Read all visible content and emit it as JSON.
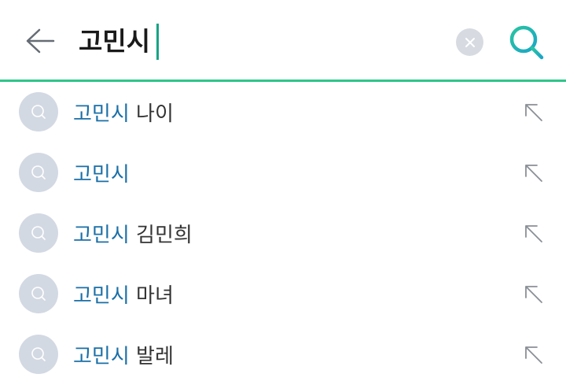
{
  "search": {
    "query": "고민시",
    "back_icon": "arrow-left-icon",
    "clear_icon": "close-icon",
    "search_icon": "search-icon",
    "accent_color": "#2fc58a"
  },
  "suggestions": [
    {
      "highlight": "고민시",
      "rest": " 나이"
    },
    {
      "highlight": "고민시",
      "rest": ""
    },
    {
      "highlight": "고민시",
      "rest": " 김민희"
    },
    {
      "highlight": "고민시",
      "rest": " 마녀"
    },
    {
      "highlight": "고민시",
      "rest": " 발레"
    }
  ],
  "suggestion_icon": "search-history-icon",
  "fill_icon": "arrow-up-left-icon",
  "colors": {
    "highlight": "#1a6fa8",
    "icon_bg": "#d3d9e3"
  }
}
